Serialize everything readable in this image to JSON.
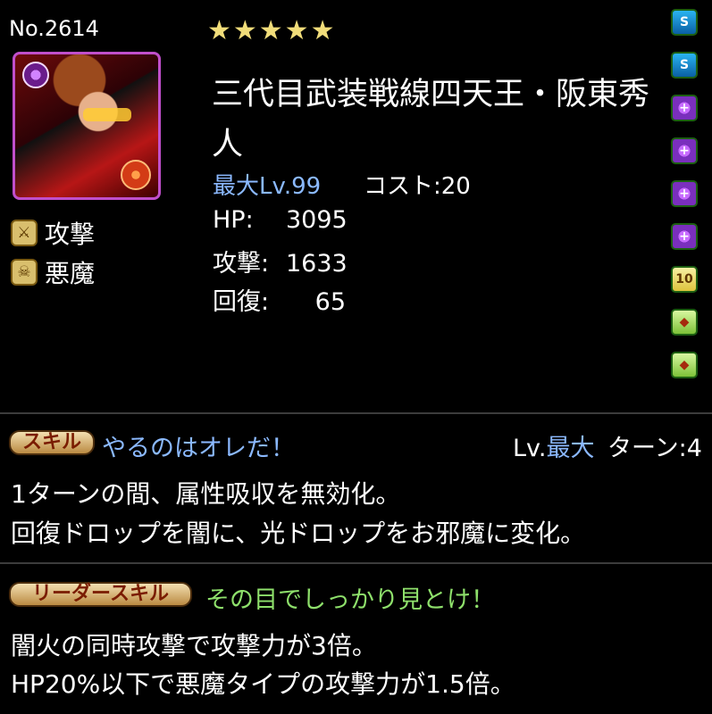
{
  "card": {
    "number": "No.2614",
    "stars": "★★★★★",
    "name": "三代目武装戦線四天王・阪東秀人",
    "max_level": "最大Lv.99",
    "cost": "コスト:20"
  },
  "types": [
    {
      "label": "攻撃",
      "icon": "attack-type-icon"
    },
    {
      "label": "悪魔",
      "icon": "devil-type-icon"
    }
  ],
  "stats": [
    {
      "label": "HP:",
      "value": "3095"
    },
    {
      "label": "攻撃:",
      "value": "1633"
    },
    {
      "label": "回復:",
      "value": "65"
    }
  ],
  "awakenings": [
    {
      "name": "skill-boost-icon",
      "glyph": "S"
    },
    {
      "name": "skill-boost-icon",
      "glyph": "S"
    },
    {
      "name": "dark-attribute-enhance-icon",
      "glyph": "+"
    },
    {
      "name": "dark-attribute-enhance-icon",
      "glyph": "+"
    },
    {
      "name": "dark-attribute-enhance-icon",
      "glyph": "+"
    },
    {
      "name": "dark-attribute-enhance-icon",
      "glyph": "+"
    },
    {
      "name": "combo-10-icon",
      "glyph": "10"
    },
    {
      "name": "devil-killer-icon",
      "glyph": "◆"
    },
    {
      "name": "attack-killer-icon",
      "glyph": "◆"
    }
  ],
  "skill": {
    "badge": "スキル",
    "name": "やるのはオレだ！",
    "level_label": "Lv.",
    "level_value": "最大",
    "turn": "ターン:4",
    "description": [
      "1ターンの間、属性吸収を無効化。",
      "回復ドロップを闇に、光ドロップをお邪魔に変化。"
    ]
  },
  "leader_skill": {
    "badge": "リーダースキル",
    "name": "その目でしっかり見とけ！",
    "description": [
      "闇火の同時攻撃で攻撃力が3倍。",
      "HP20%以下で悪魔タイプの攻撃力が1.5倍。"
    ]
  }
}
